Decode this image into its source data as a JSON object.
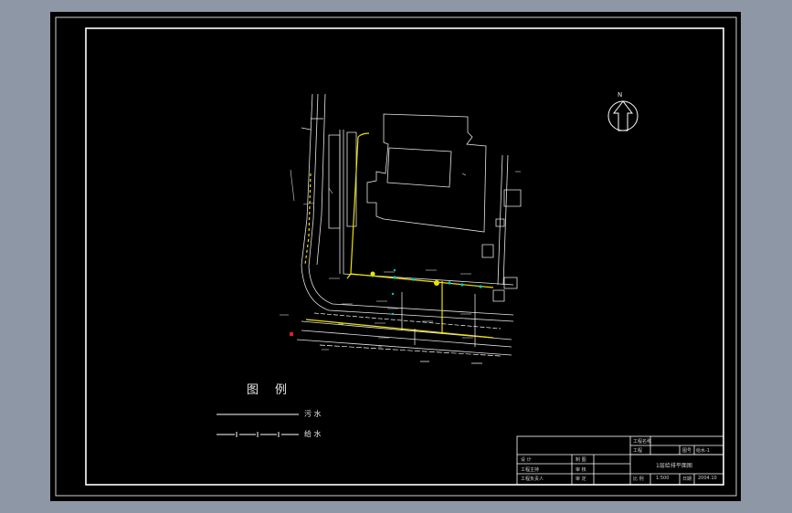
{
  "legend": {
    "title_chars": [
      "图",
      "例"
    ],
    "items": [
      {
        "label": "污 水",
        "style": "solid"
      },
      {
        "label": "给 水",
        "style": "dash-dot"
      }
    ]
  },
  "north": {
    "label": "N"
  },
  "title_block": {
    "project_name_label": "工程名称",
    "project_label": "工程",
    "drawing_title": "1层给排平面图",
    "drawing_no_label": "图号",
    "drawing_no": "给水-1",
    "rows_left": [
      "设 计",
      "工程主持",
      "工程负责人"
    ],
    "rows_mid": [
      "制 图",
      "审 核",
      "审 定"
    ],
    "scale_label": "比 例",
    "scale": "1:500",
    "date_label": "日期",
    "date": "2004.10"
  },
  "colors": {
    "paper": "#000000",
    "frame": "#ffffff",
    "water_supply": "#f0e000",
    "sewage": "#ffffff",
    "outlet": "#00c8c8",
    "marker_red": "#e02020",
    "background": "#8e97a6"
  }
}
